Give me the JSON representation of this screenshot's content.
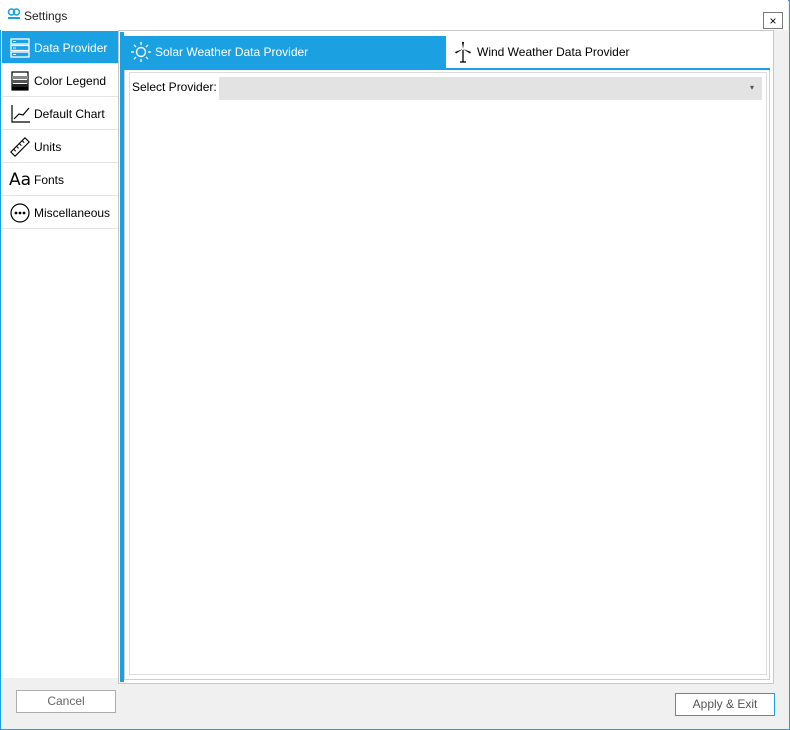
{
  "window": {
    "title": "Settings",
    "close_glyph": "×",
    "app_icon": "app-logo-icon"
  },
  "sidebar": {
    "items": [
      {
        "label": "Data Provider",
        "icon": "database-icon",
        "active": true
      },
      {
        "label": "Color Legend",
        "icon": "color-legend-icon",
        "active": false
      },
      {
        "label": "Default Chart",
        "icon": "line-chart-icon",
        "active": false
      },
      {
        "label": "Units",
        "icon": "ruler-icon",
        "active": false
      },
      {
        "label": "Fonts",
        "icon": "fonts-icon",
        "active": false
      },
      {
        "label": "Miscellaneous",
        "icon": "ellipsis-circle-icon",
        "active": false
      }
    ],
    "font_icon_text": "Aa"
  },
  "tabs": [
    {
      "label": "Solar Weather Data Provider",
      "icon": "sun-icon",
      "active": true
    },
    {
      "label": "Wind Weather Data Provider",
      "icon": "wind-turbine-icon",
      "active": false
    }
  ],
  "provider": {
    "label": "Select Provider:",
    "value": "",
    "arrow": "▾"
  },
  "buttons": {
    "cancel": "Cancel",
    "apply": "Apply & Exit"
  },
  "colors": {
    "accent": "#1ba1e2",
    "select_bg": "#e3e3e3"
  }
}
